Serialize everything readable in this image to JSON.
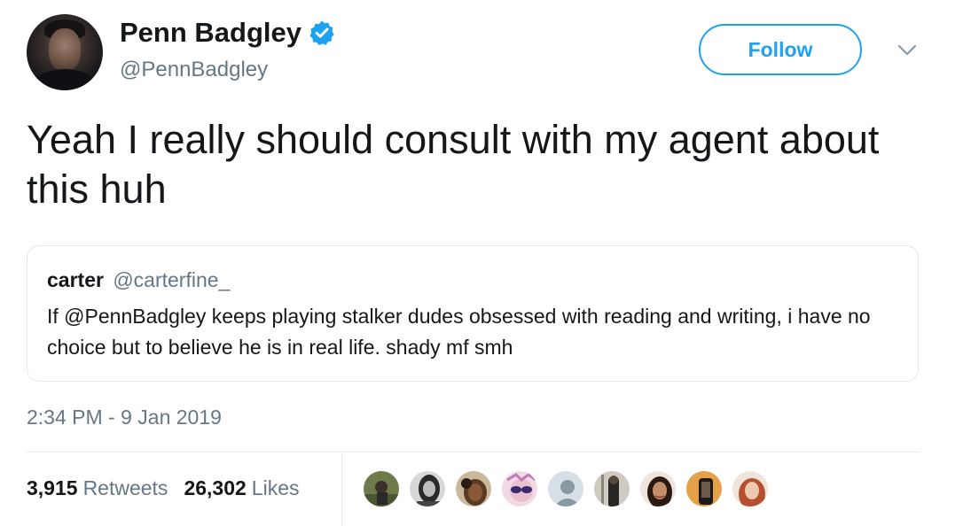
{
  "tweet": {
    "author": {
      "display_name": "Penn Badgley",
      "handle": "@PennBadgley",
      "avatar_icon": "profile-photo",
      "verified_icon": "verified-badge-icon"
    },
    "follow_label": "Follow",
    "menu_icon": "chevron-down-icon",
    "text": "Yeah I really should consult with my agent about this huh",
    "quoted": {
      "display_name": "carter",
      "handle": "@carterfine_",
      "text": "If @PennBadgley keeps playing stalker dudes obsessed with reading and writing, i have no choice but to believe he is in real life. shady mf smh"
    },
    "timestamp": "2:34 PM - 9 Jan 2019",
    "retweets": {
      "count": "3,915",
      "label": "Retweets"
    },
    "likes": {
      "count": "26,302",
      "label": "Likes"
    },
    "liker_avatars": [
      "liker-avatar-1",
      "liker-avatar-2",
      "liker-avatar-3",
      "liker-avatar-4",
      "liker-avatar-5",
      "liker-avatar-6",
      "liker-avatar-7",
      "liker-avatar-8",
      "liker-avatar-9"
    ]
  },
  "colors": {
    "accent": "#1da1f2",
    "text": "#14171a",
    "secondary_text": "#657786",
    "border": "#e1e8ed"
  }
}
